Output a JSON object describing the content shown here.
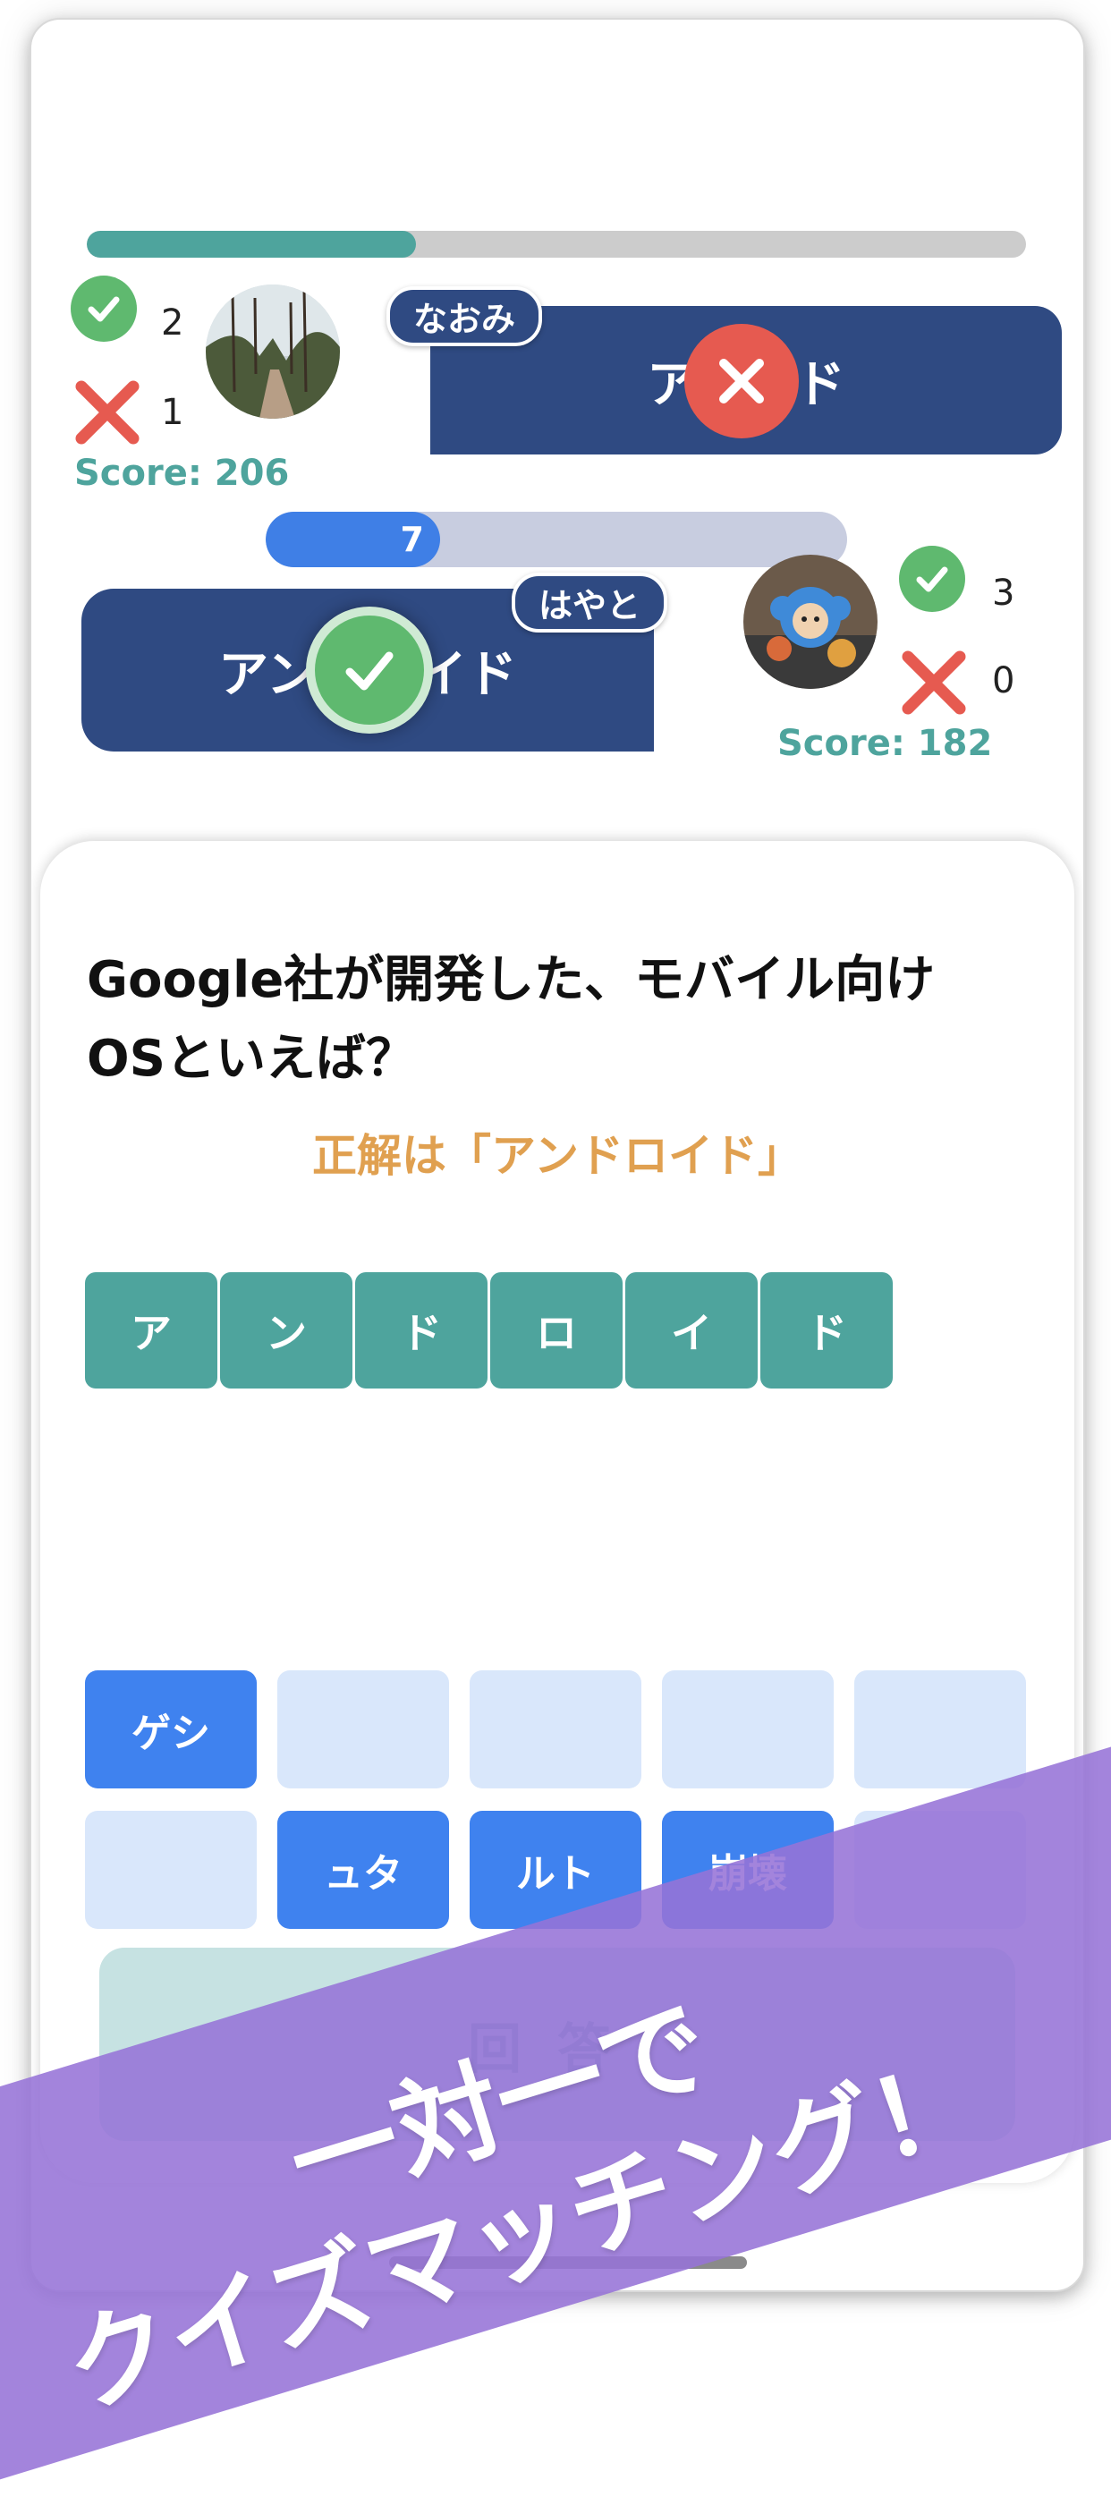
{
  "progress": {
    "fraction": 0.35
  },
  "opponent": {
    "name": "なおみ",
    "correct_count": "2",
    "wrong_count": "1",
    "score": "Score: 206",
    "answer": "アンドド",
    "result": "wrong"
  },
  "timer": {
    "value": "7",
    "fraction": 0.3
  },
  "player": {
    "name": "はやと",
    "correct_count": "3",
    "wrong_count": "0",
    "score": "Score: 182",
    "answer": "アンドロイド",
    "result": "correct"
  },
  "question": {
    "line1": "Google社が開発した、モバイル向け",
    "line2": "OSといえば？",
    "correct_message": "正解は「アンドロイド」"
  },
  "answer_tiles": [
    "ア",
    "ン",
    "ド",
    "ロ",
    "イ",
    "ド"
  ],
  "keyboard": {
    "row1": [
      {
        "label": "ゲシ",
        "active": true
      },
      {
        "label": "",
        "active": false
      },
      {
        "label": "",
        "active": false
      },
      {
        "label": "",
        "active": false
      },
      {
        "label": "",
        "active": false
      }
    ],
    "row2": [
      {
        "label": "",
        "active": false
      },
      {
        "label": "ュタ",
        "active": true
      },
      {
        "label": "ルト",
        "active": true
      },
      {
        "label": "崩壊",
        "active": true
      },
      {
        "label": "",
        "active": false
      }
    ]
  },
  "submit_label": "回答",
  "banner": {
    "line1": "一対一で",
    "line2": "クイズマッチング！"
  },
  "colors": {
    "accent": "#4ea49d",
    "answer_box": "#2f4a82",
    "correct": "#5fb96f",
    "wrong": "#e65a50",
    "key_active": "#3f82ef",
    "banner": "#9673d7"
  }
}
